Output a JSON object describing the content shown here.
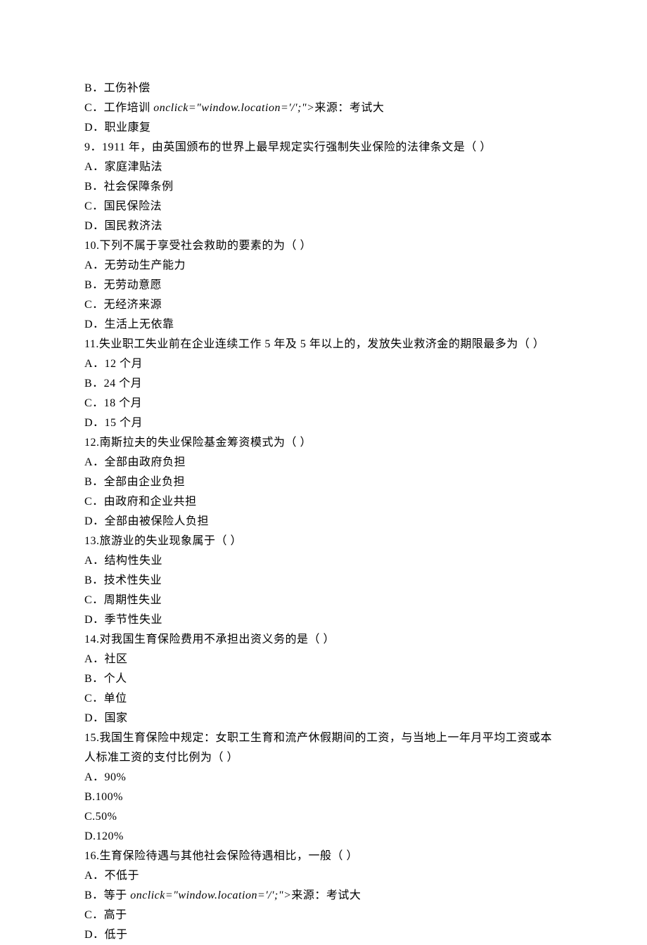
{
  "lines": [
    {
      "type": "plain",
      "text": "B．工伤补偿"
    },
    {
      "type": "with_onclick",
      "prefix": "C．工作培训 ",
      "onclick": "onclick=\"window.location='/';\">",
      "suffix": "来源：考试大"
    },
    {
      "type": "plain",
      "text": "D．职业康复"
    },
    {
      "type": "plain",
      "text": "9．1911 年，由英国颁布的世界上最早规定实行强制失业保险的法律条文是（ ）"
    },
    {
      "type": "plain",
      "text": "A．家庭津贴法"
    },
    {
      "type": "plain",
      "text": "B．社会保障条例"
    },
    {
      "type": "plain",
      "text": "C．国民保险法"
    },
    {
      "type": "plain",
      "text": "D．国民救济法"
    },
    {
      "type": "plain",
      "text": "10.下列不属于享受社会救助的要素的为（ ）"
    },
    {
      "type": "plain",
      "text": "A．无劳动生产能力"
    },
    {
      "type": "plain",
      "text": "B．无劳动意愿"
    },
    {
      "type": "plain",
      "text": "C．无经济来源"
    },
    {
      "type": "plain",
      "text": "D．生活上无依靠"
    },
    {
      "type": "plain",
      "text": "11.失业职工失业前在企业连续工作 5 年及 5 年以上的，发放失业救济金的期限最多为（ ）"
    },
    {
      "type": "plain",
      "text": "A．12 个月"
    },
    {
      "type": "plain",
      "text": "B．24 个月"
    },
    {
      "type": "plain",
      "text": "C．18 个月"
    },
    {
      "type": "plain",
      "text": "D．15 个月"
    },
    {
      "type": "plain",
      "text": "12.南斯拉夫的失业保险基金筹资模式为（ ）"
    },
    {
      "type": "plain",
      "text": "A．全部由政府负担"
    },
    {
      "type": "plain",
      "text": "B．全部由企业负担"
    },
    {
      "type": "plain",
      "text": "C．由政府和企业共担"
    },
    {
      "type": "plain",
      "text": "D．全部由被保险人负担"
    },
    {
      "type": "plain",
      "text": "13.旅游业的失业现象属于（ ）"
    },
    {
      "type": "plain",
      "text": "A．结构性失业"
    },
    {
      "type": "plain",
      "text": "B．技术性失业"
    },
    {
      "type": "plain",
      "text": "C．周期性失业"
    },
    {
      "type": "plain",
      "text": "D．季节性失业"
    },
    {
      "type": "plain",
      "text": "14.对我国生育保险费用不承担出资义务的是（ ）"
    },
    {
      "type": "plain",
      "text": "A．社区"
    },
    {
      "type": "plain",
      "text": "B．个人"
    },
    {
      "type": "plain",
      "text": "C．单位"
    },
    {
      "type": "plain",
      "text": "D．国家"
    },
    {
      "type": "plain",
      "text": "15.我国生育保险中规定：女职工生育和流产休假期间的工资，与当地上一年月平均工资或本人标准工资的支付比例为（ ）"
    },
    {
      "type": "plain",
      "text": "A．90%"
    },
    {
      "type": "plain",
      "text": "B.100%"
    },
    {
      "type": "plain",
      "text": "C.50%"
    },
    {
      "type": "plain",
      "text": "D.120%"
    },
    {
      "type": "plain",
      "text": "16.生育保险待遇与其他社会保险待遇相比，一般（ ）"
    },
    {
      "type": "plain",
      "text": "A．不低于"
    },
    {
      "type": "with_onclick",
      "prefix": "B．等于 ",
      "onclick": "onclick=\"window.location='/';\">",
      "suffix": "来源：考试大"
    },
    {
      "type": "plain",
      "text": "C．高于"
    },
    {
      "type": "plain",
      "text": "D．低于"
    }
  ]
}
